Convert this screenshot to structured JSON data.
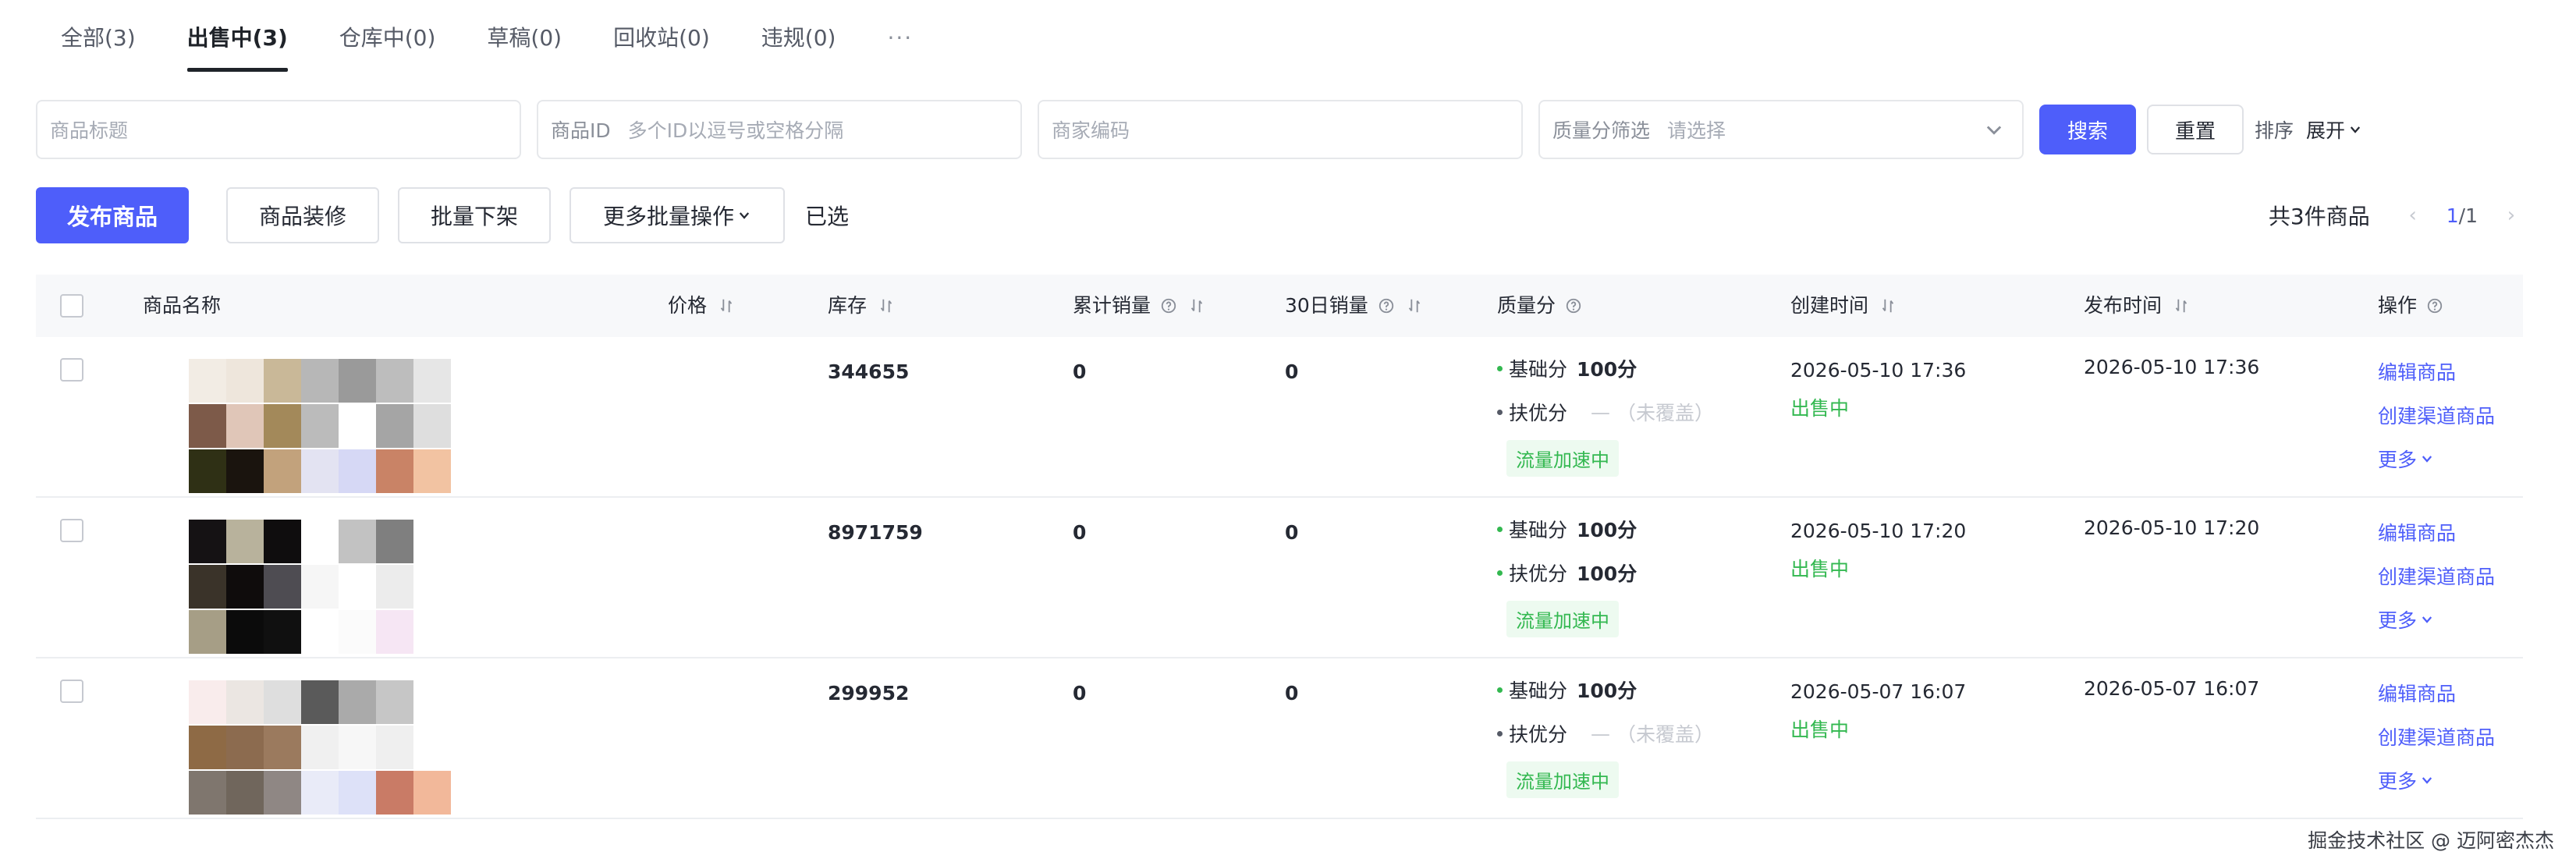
{
  "tabs": [
    {
      "label": "全部(3)",
      "active": false
    },
    {
      "label": "出售中(3)",
      "active": true
    },
    {
      "label": "仓库中(0)",
      "active": false
    },
    {
      "label": "草稿(0)",
      "active": false
    },
    {
      "label": "回收站(0)",
      "active": false
    },
    {
      "label": "违规(0)",
      "active": false
    }
  ],
  "tabs_more": "···",
  "filters": {
    "title_placeholder": "商品标题",
    "id_label": "商品ID",
    "id_placeholder": "多个ID以逗号或空格分隔",
    "code_placeholder": "商家编码",
    "quality_label": "质量分筛选",
    "quality_placeholder": "请选择",
    "search_label": "搜索",
    "reset_label": "重置",
    "sort_label": "排序",
    "expand_label": "展开"
  },
  "actions": {
    "publish_label": "发布商品",
    "decorate_label": "商品装修",
    "batch_offline_label": "批量下架",
    "more_batch_label": "更多批量操作",
    "selected_label": "已选",
    "total_label": "共3件商品",
    "page_current": "1",
    "page_total": "/1"
  },
  "columns": {
    "name": "商品名称",
    "price": "价格",
    "stock": "库存",
    "total_sales": "累计销量",
    "sales_30d": "30日销量",
    "quality": "质量分",
    "created": "创建时间",
    "published": "发布时间",
    "ops": "操作"
  },
  "rows": [
    {
      "stock": "344655",
      "total_sales": "0",
      "sales_30d": "0",
      "quality": [
        {
          "name": "基础分",
          "value": "100分",
          "dot": "#33b850"
        },
        {
          "name": "扶优分",
          "dash": "—",
          "empty": "（未覆盖）",
          "dot": "#555a66"
        }
      ],
      "boost": "流量加速中",
      "created": "2026-05-10 17:36",
      "status": "出售中",
      "published": "2026-05-10 17:36",
      "ops": [
        "编辑商品",
        "创建渠道商品",
        "更多"
      ]
    },
    {
      "stock": "8971759",
      "total_sales": "0",
      "sales_30d": "0",
      "quality": [
        {
          "name": "基础分",
          "value": "100分",
          "dot": "#33b850"
        },
        {
          "name": "扶优分",
          "value": "100分",
          "dot": "#33b850"
        }
      ],
      "boost": "流量加速中",
      "created": "2026-05-10 17:20",
      "status": "出售中",
      "published": "2026-05-10 17:20",
      "ops": [
        "编辑商品",
        "创建渠道商品",
        "更多"
      ]
    },
    {
      "stock": "299952",
      "total_sales": "0",
      "sales_30d": "0",
      "quality": [
        {
          "name": "基础分",
          "value": "100分",
          "dot": "#33b850"
        },
        {
          "name": "扶优分",
          "dash": "—",
          "empty": "（未覆盖）",
          "dot": "#555a66"
        }
      ],
      "boost": "流量加速中",
      "created": "2026-05-07 16:07",
      "status": "出售中",
      "published": "2026-05-07 16:07",
      "ops": [
        "编辑商品",
        "创建渠道商品",
        "更多"
      ]
    }
  ],
  "watermark": "掘金技术社区 @ 迈阿密杰杰",
  "colors": {
    "accent": "#4e5efa",
    "success": "#33b850",
    "boost_bg": "#edfaf0"
  },
  "thumbnails": [
    {
      "rows": [
        [
          "#f2ece4",
          "#eee6dc",
          "#c9b898",
          "#b7b7b7",
          "#9a9a9a",
          "#bdbdbd",
          "#e6e6e6"
        ],
        [
          "#7d5a49",
          "#e0c6b8",
          "#a3895a",
          "#bbbbbb",
          "#ffffff",
          "#a5a5a5",
          "#dedede"
        ],
        [
          "#2f3015",
          "#1a140e",
          "#c2a27c",
          "#e3e3f2",
          "#d6d8f5",
          "#c98366",
          "#f2c3a2"
        ]
      ]
    },
    {
      "rows": [
        [
          "#151214",
          "#b8b29c",
          "#0f0d0e",
          "#ffffff",
          "#c2c2c2",
          "#7f7f7f",
          "#ffffff"
        ],
        [
          "#3a3329",
          "#0f0c0c",
          "#4e4c52",
          "#f6f6f6",
          "#ffffff",
          "#ececec",
          "#ffffff"
        ],
        [
          "#a69e86",
          "#0b0b0b",
          "#101010",
          "#ffffff",
          "#fbfbfb",
          "#f6e6f4",
          "#ffffff"
        ]
      ]
    },
    {
      "rows": [
        [
          "#f9ecec",
          "#ebe6e2",
          "#dedede",
          "#5a5a5a",
          "#aaaaaa",
          "#c6c6c6",
          "#ffffff"
        ],
        [
          "#8e6a45",
          "#8c6b4f",
          "#9b7a5e",
          "#f0f0f0",
          "#f7f7f7",
          "#efefef",
          "#ffffff"
        ],
        [
          "#7f766e",
          "#70665c",
          "#8f8784",
          "#e9ebf8",
          "#dde1f8",
          "#c97b66",
          "#f2b89a"
        ]
      ]
    }
  ]
}
